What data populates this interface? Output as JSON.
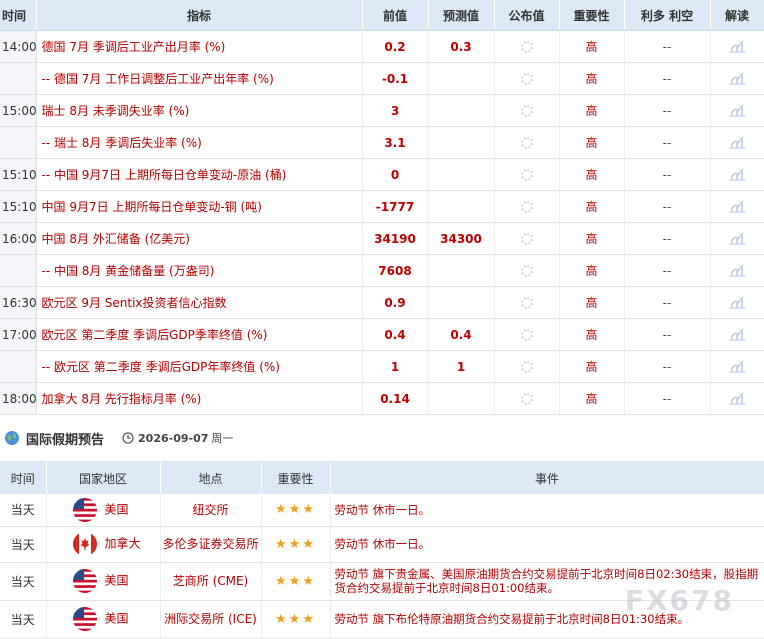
{
  "calendar": {
    "headers": {
      "time": "时间",
      "indicator": "指标",
      "previous": "前值",
      "forecast": "预测值",
      "actual": "公布值",
      "importance": "重要性",
      "impact": "利多 利空",
      "interpret": "解读"
    },
    "rows": [
      {
        "time": "14:00",
        "indicator": "德国 7月 季调后工业产出月率 (%)",
        "previous": "0.2",
        "forecast": "0.3",
        "importance": "高",
        "impact": "--"
      },
      {
        "time": "",
        "indicator": "-- 德国 7月 工作日调整后工业产出年率 (%)",
        "previous": "-0.1",
        "forecast": "",
        "importance": "高",
        "impact": "--"
      },
      {
        "time": "15:00",
        "indicator": "瑞士 8月 未季调失业率 (%)",
        "previous": "3",
        "forecast": "",
        "importance": "高",
        "impact": "--"
      },
      {
        "time": "",
        "indicator": "-- 瑞士 8月 季调后失业率 (%)",
        "previous": "3.1",
        "forecast": "",
        "importance": "高",
        "impact": "--"
      },
      {
        "time": "15:10",
        "indicator": "-- 中国 9月7日 上期所每日仓单变动-原油 (桶)",
        "previous": "0",
        "forecast": "",
        "importance": "高",
        "impact": "--"
      },
      {
        "time": "15:10",
        "indicator": "中国 9月7日 上期所每日仓单变动-铜 (吨)",
        "previous": "-1777",
        "forecast": "",
        "importance": "高",
        "impact": "--"
      },
      {
        "time": "16:00",
        "indicator": "中国 8月 外汇储备 (亿美元)",
        "previous": "34190",
        "forecast": "34300",
        "importance": "高",
        "impact": "--"
      },
      {
        "time": "",
        "indicator": "-- 中国 8月 黄金储备量 (万盎司)",
        "previous": "7608",
        "forecast": "",
        "importance": "高",
        "impact": "--"
      },
      {
        "time": "16:30",
        "indicator": "欧元区 9月 Sentix投资者信心指数",
        "previous": "0.9",
        "forecast": "",
        "importance": "高",
        "impact": "--"
      },
      {
        "time": "17:00",
        "indicator": "欧元区 第二季度 季调后GDP季率终值 (%)",
        "previous": "0.4",
        "forecast": "0.4",
        "importance": "高",
        "impact": "--"
      },
      {
        "time": "",
        "indicator": "-- 欧元区 第二季度 季调后GDP年率终值 (%)",
        "previous": "1",
        "forecast": "1",
        "importance": "高",
        "impact": "--"
      },
      {
        "time": "18:00",
        "indicator": "加拿大 8月 先行指标月率 (%)",
        "previous": "0.14",
        "forecast": "",
        "importance": "高",
        "impact": "--"
      }
    ]
  },
  "holidays": {
    "section_title": "国际假期预告",
    "date": "2026-09-07",
    "weekday": "周一",
    "headers": {
      "time": "时间",
      "region": "国家地区",
      "place": "地点",
      "importance": "重要性",
      "event": "事件"
    },
    "rows": [
      {
        "time": "当天",
        "region": "美国",
        "flag": "us",
        "place": "纽交所",
        "stars": "★★★",
        "event": "劳动节 休市一日。"
      },
      {
        "time": "当天",
        "region": "加拿大",
        "flag": "ca",
        "place": "多伦多证券交易所",
        "stars": "★★★",
        "event": "劳动节 休市一日。"
      },
      {
        "time": "当天",
        "region": "美国",
        "flag": "us",
        "place": "芝商所 (CME)",
        "stars": "★★★",
        "event": "劳动节 旗下贵金属、美国原油期货合约交易提前于北京时间8日02:30结束，股指期货合约交易提前于北京时间8日01:00结束。"
      },
      {
        "time": "当天",
        "region": "美国",
        "flag": "us",
        "place": "洲际交易所 (ICE)",
        "stars": "★★★",
        "event": "劳动节 旗下布伦特原油期货合约交易提前于北京时间8日01:30结束。"
      }
    ]
  },
  "watermark": "FX678",
  "colors": {
    "header_bg": "#dce8f6",
    "accent_red": "#c00000",
    "star": "#f0a020"
  }
}
